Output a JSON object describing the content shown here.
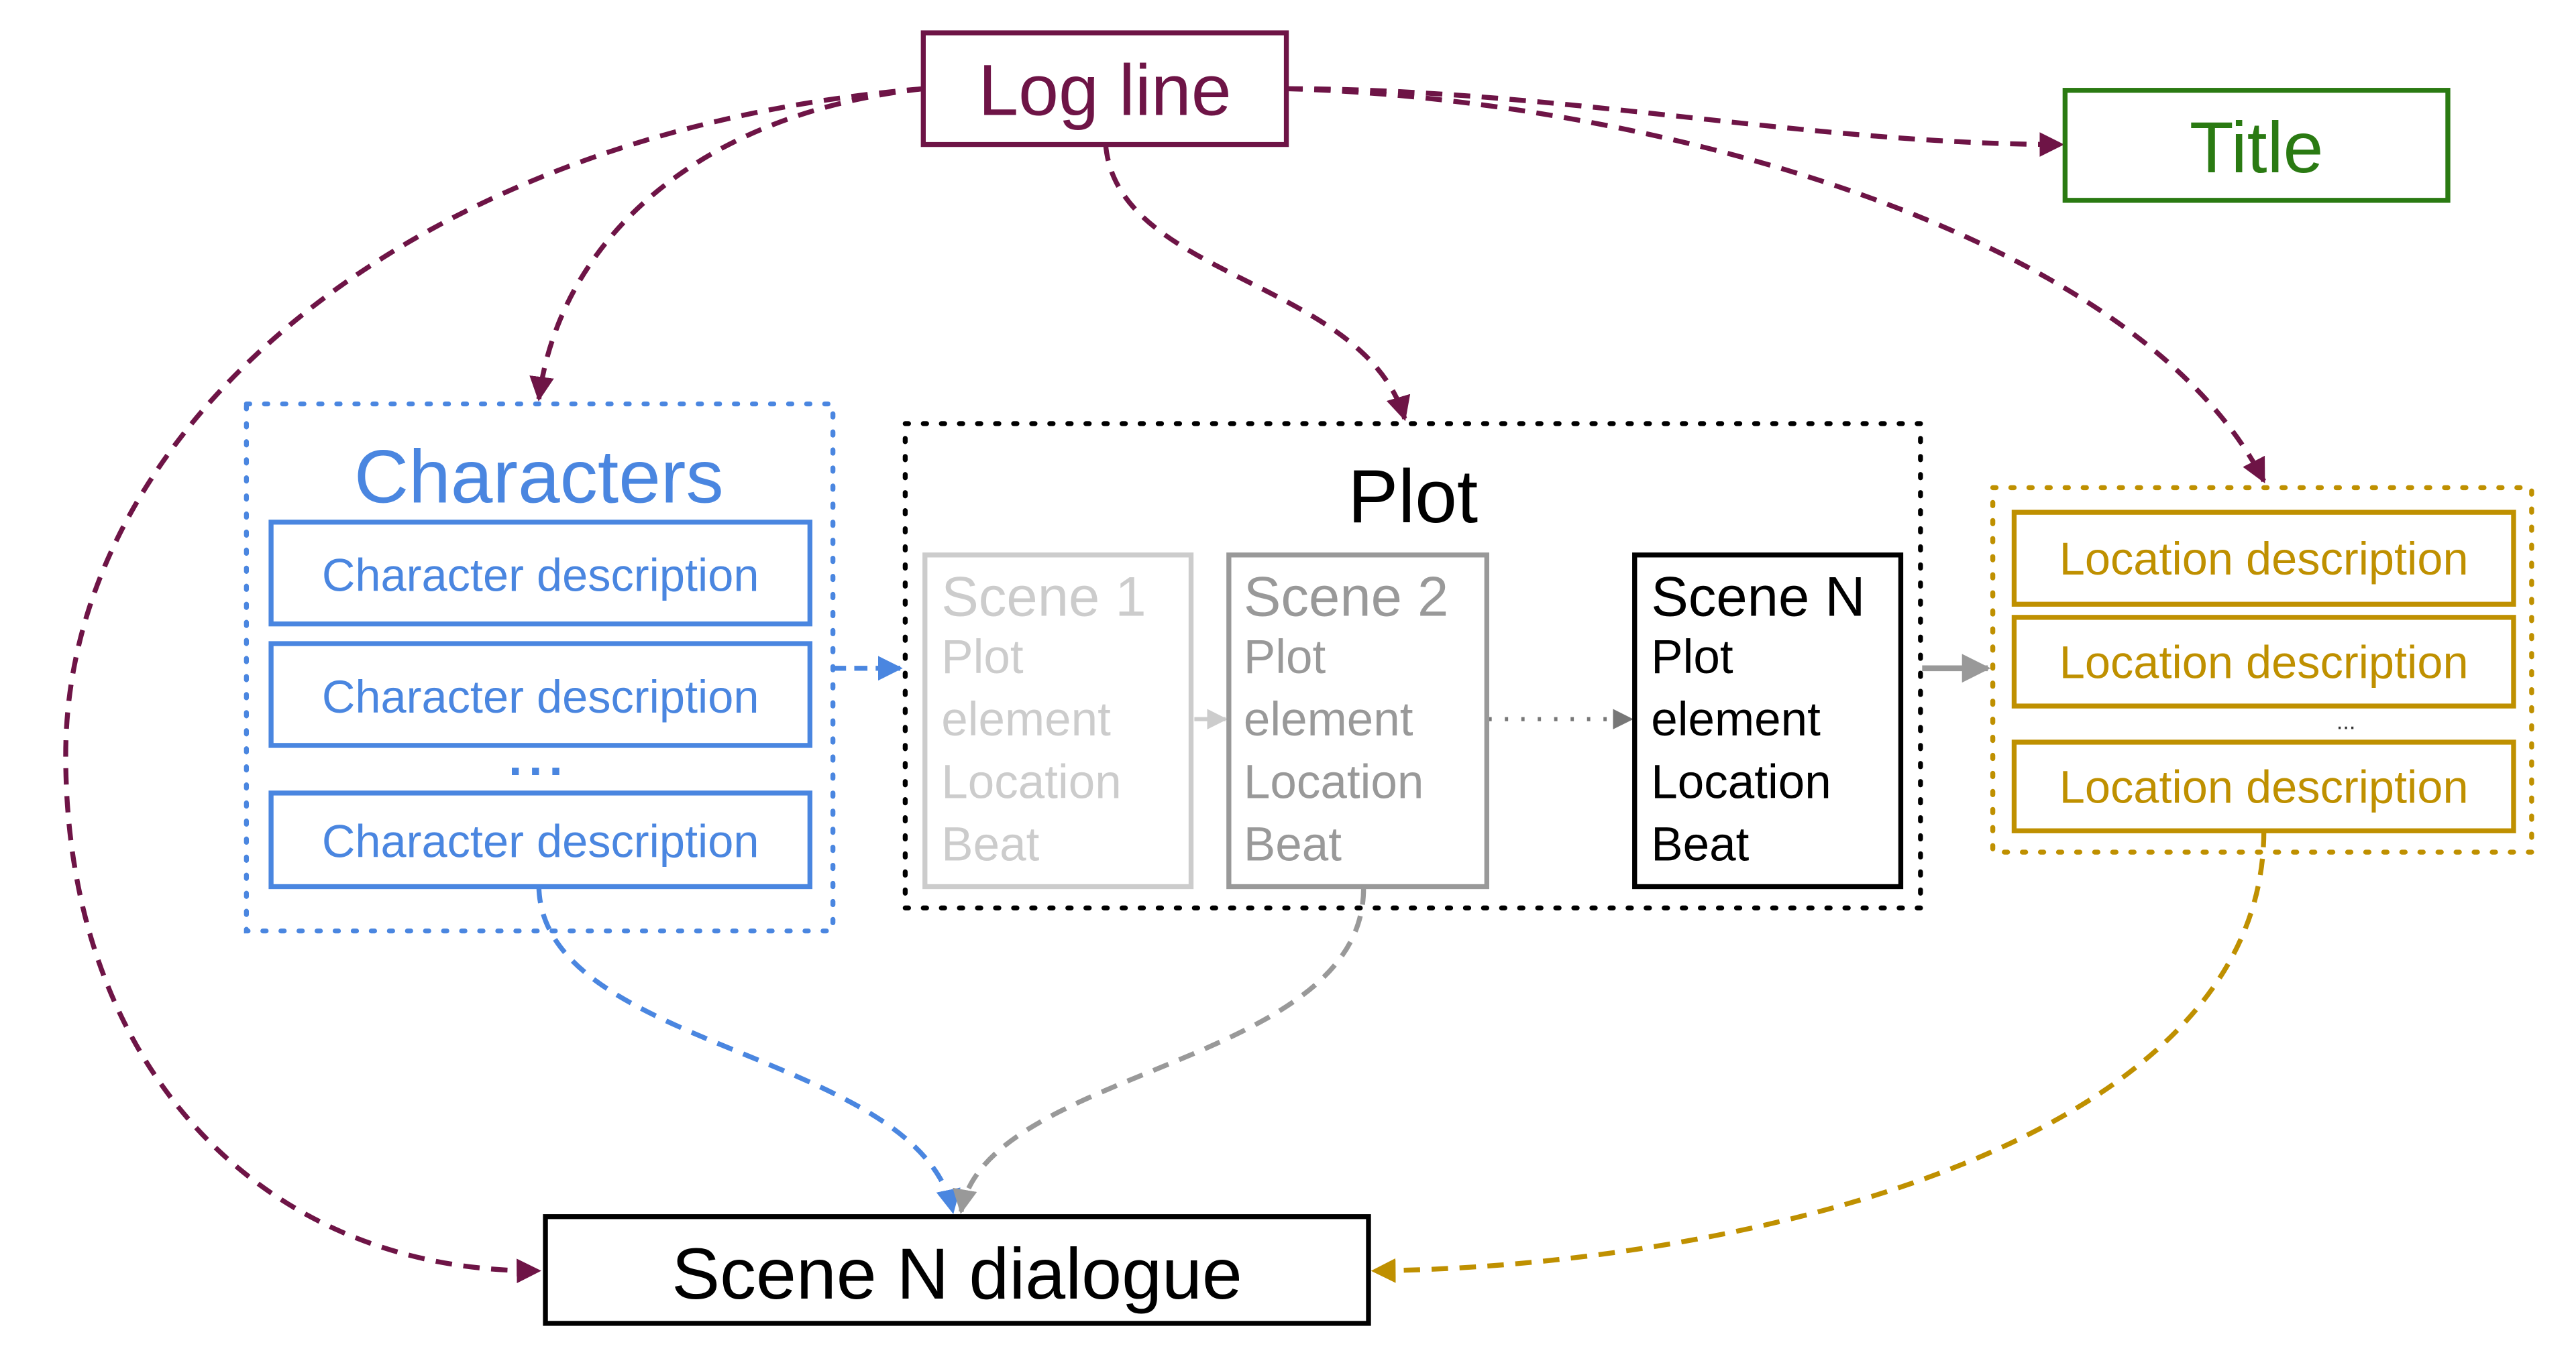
{
  "colors": {
    "logline": "#6e1446",
    "title": "#2a7a12",
    "characters": "#4a86e0",
    "plot": "#000000",
    "scene1": "#cccccc",
    "scene2": "#999999",
    "location": "#bf9000",
    "connector_gray": "#999999"
  },
  "nodes": {
    "logline": "Log line",
    "title": "Title",
    "characters": {
      "heading": "Characters",
      "items": [
        "Character description",
        "Character description",
        "Character description"
      ],
      "ellipsis": "..."
    },
    "plot": {
      "heading": "Plot",
      "scenes": [
        {
          "title": "Scene 1",
          "lines": [
            "Plot",
            "element",
            "Location",
            "Beat"
          ]
        },
        {
          "title": "Scene 2",
          "lines": [
            "Plot",
            "element",
            "Location",
            "Beat"
          ]
        },
        {
          "title": "Scene N",
          "lines": [
            "Plot",
            "element",
            "Location",
            "Beat"
          ]
        }
      ],
      "ellipsis": "..."
    },
    "locations": {
      "items": [
        "Location description",
        "Location description",
        "Location description"
      ],
      "ellipsis": "..."
    },
    "dialogue": "Scene N dialogue"
  },
  "edges": [
    {
      "from": "Log line",
      "to": "Title",
      "style": "dashed"
    },
    {
      "from": "Log line",
      "to": "Characters",
      "style": "dashed"
    },
    {
      "from": "Log line",
      "to": "Plot",
      "style": "dashed"
    },
    {
      "from": "Log line",
      "to": "Locations",
      "style": "dashed"
    },
    {
      "from": "Log line",
      "to": "Scene N dialogue",
      "style": "dashed"
    },
    {
      "from": "Characters",
      "to": "Plot",
      "style": "dashed"
    },
    {
      "from": "Scene 1",
      "to": "Scene 2",
      "style": "solid"
    },
    {
      "from": "Scene 2",
      "to": "Scene N",
      "style": "dotted"
    },
    {
      "from": "Plot",
      "to": "Locations",
      "style": "solid"
    },
    {
      "from": "Characters",
      "to": "Scene N dialogue",
      "style": "dashed"
    },
    {
      "from": "Scene 2",
      "to": "Scene N dialogue",
      "style": "dashed"
    },
    {
      "from": "Locations",
      "to": "Scene N dialogue",
      "style": "dashed"
    }
  ]
}
